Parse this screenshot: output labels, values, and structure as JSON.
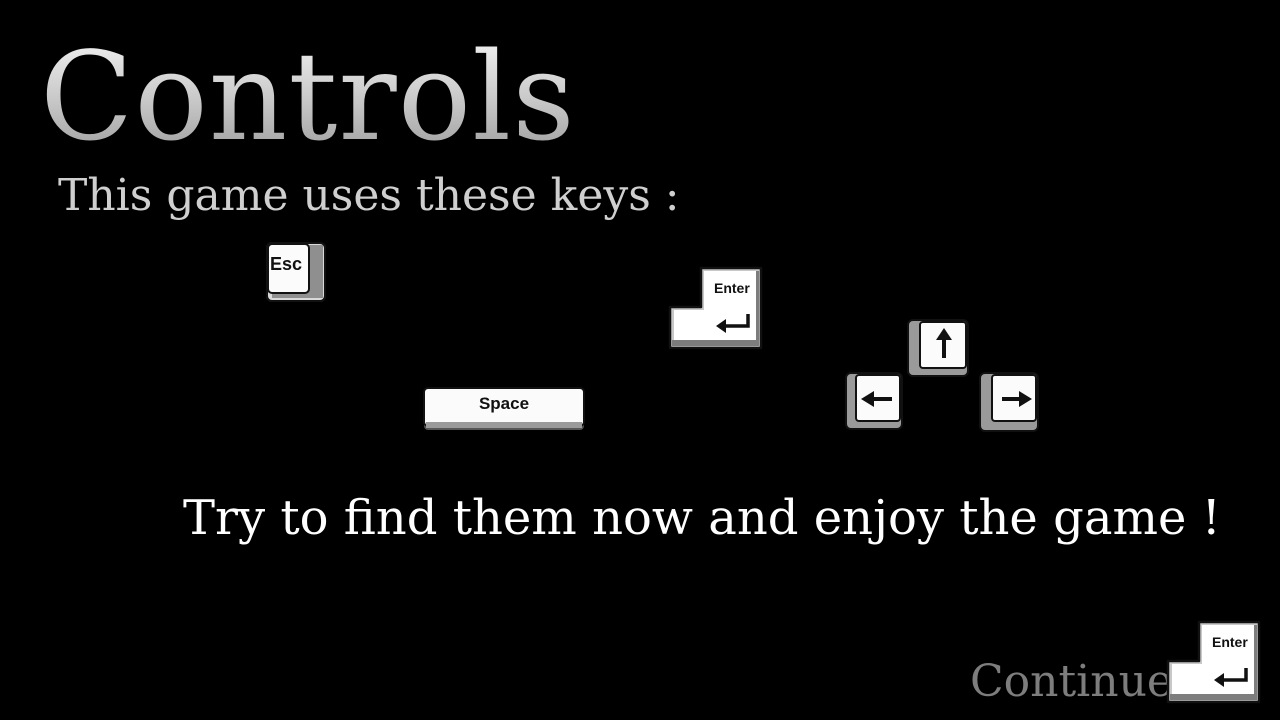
{
  "title": "Controls",
  "subtitle": "This game uses these keys :",
  "keys": {
    "esc": "Esc",
    "enter": "Enter",
    "space": "Space",
    "up_icon": "arrow-up-icon",
    "left_icon": "arrow-left-icon",
    "right_icon": "arrow-right-icon",
    "return_icon": "return-arrow-icon"
  },
  "message": "Try to find them now and enjoy the game !",
  "continue": {
    "label": "Continue",
    "key_label": "Enter"
  }
}
